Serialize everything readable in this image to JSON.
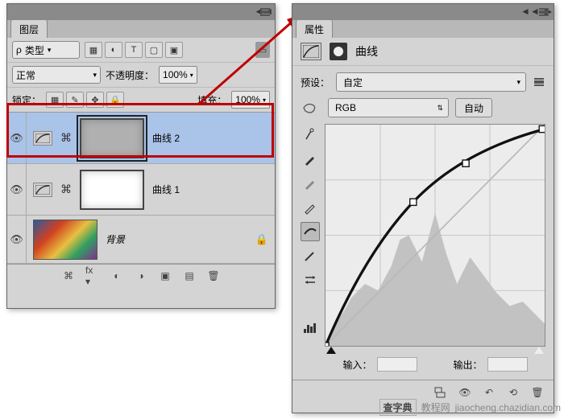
{
  "layers_panel": {
    "title": "图层",
    "header_collapse_glyphs": [
      "◄◄",
      "▶"
    ],
    "filter": {
      "label": "ρ",
      "value": "类型"
    },
    "filter_icons": [
      "▦",
      "◐",
      "T",
      "▢",
      "▣"
    ],
    "filter_toggle": "▭",
    "blend": {
      "value": "正常"
    },
    "opacity_label": "不透明度：",
    "opacity_value": "100%",
    "lock_label": "锁定：",
    "lock_icons": [
      "▦",
      "✎",
      "✥",
      "🔒"
    ],
    "fill_label": "填充：",
    "fill_value": "100%",
    "layers": [
      {
        "name": "曲线 2",
        "selected": true,
        "mask": "texture"
      },
      {
        "name": "曲线 1",
        "selected": false,
        "mask": "white"
      },
      {
        "name": "背景",
        "selected": false,
        "locked": true,
        "bg": true
      }
    ],
    "bottom_icons": [
      "⌘",
      "fx ▾",
      "◐",
      "◑",
      "▣",
      "▤",
      "🗑"
    ]
  },
  "properties_panel": {
    "title_tab": "属性",
    "title": "曲线",
    "preset_label": "预设：",
    "preset_value": "自定",
    "channel_value": "RGB",
    "auto_label": "自动",
    "input_label": "输入：",
    "output_label": "输出：",
    "tool_icons": [
      "✥",
      "✎",
      "✎",
      "✎",
      "〜",
      "✎",
      "⇄",
      "📊"
    ]
  },
  "watermark": {
    "text1": "查字典",
    "text2": "教程网",
    "url": "jiaocheng.chazidian.com"
  }
}
